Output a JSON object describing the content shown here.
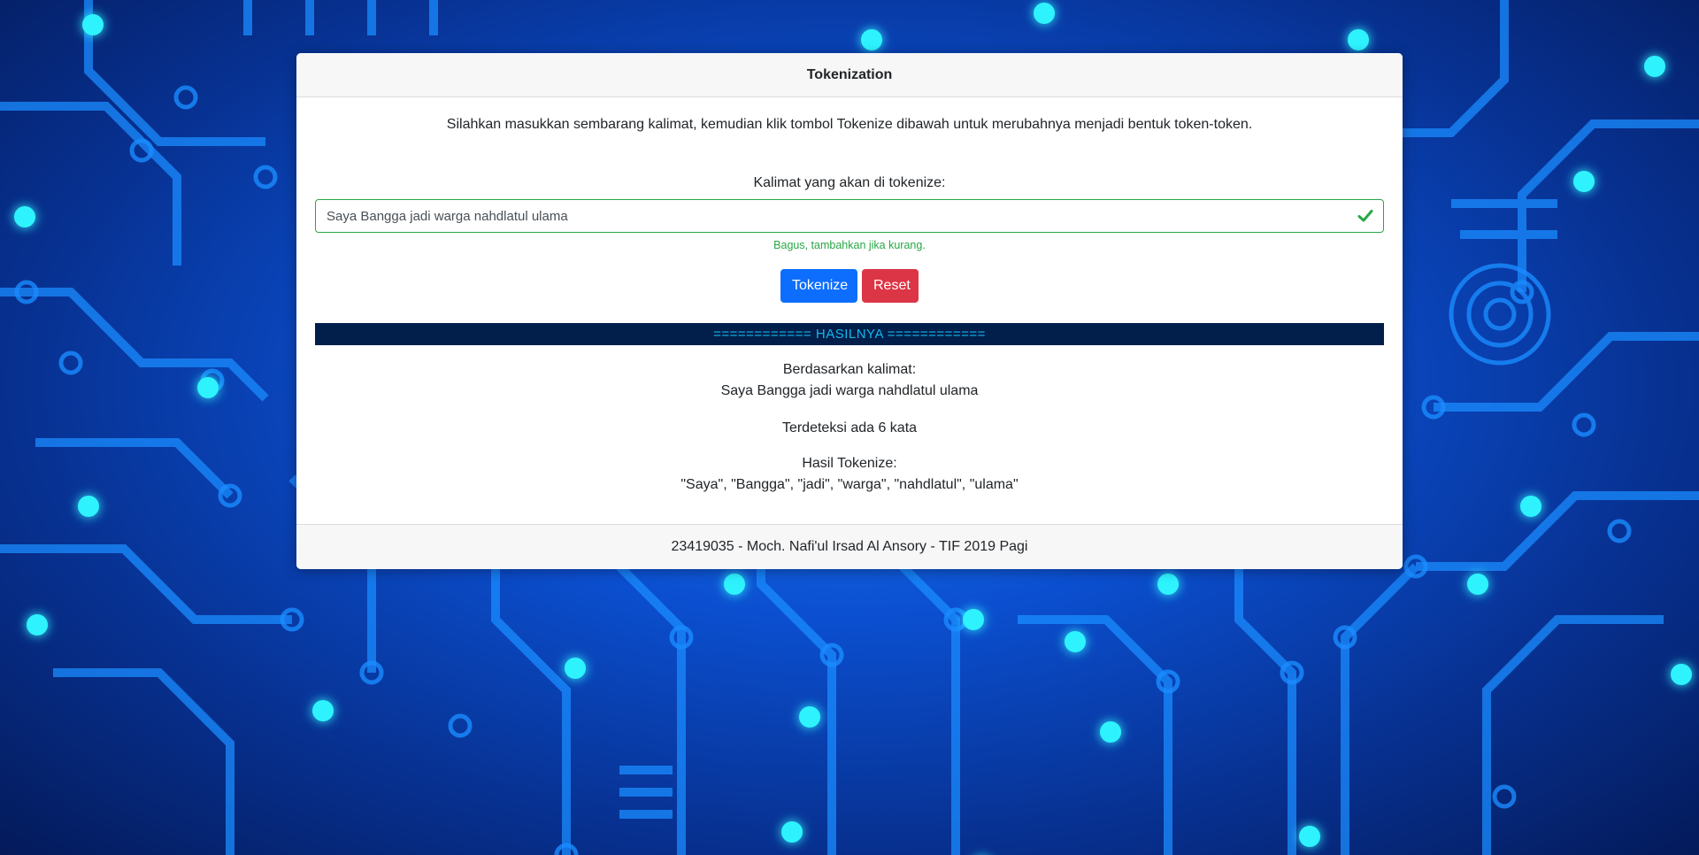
{
  "card": {
    "title": "Tokenization",
    "intro": "Silahkan masukkan sembarang kalimat, kemudian klik tombol Tokenize dibawah untuk merubahnya menjadi bentuk token-token.",
    "input_label": "Kalimat yang akan di tokenize:",
    "input_value": "Saya Bangga jadi warga nahdlatul ulama",
    "valid_feedback": "Bagus, tambahkan jika kurang.",
    "tokenize_button": "Tokenize",
    "reset_button": "Reset",
    "result_banner": "============ HASILNYA ============",
    "based_on_label": "Berdasarkan kalimat:",
    "based_on_value": "Saya Bangga jadi warga nahdlatul ulama",
    "word_count_text": "Terdeteksi ada 6 kata",
    "tokens_label": "Hasil Tokenize:",
    "tokens_value": "\"Saya\", \"Bangga\", \"jadi\", \"warga\", \"nahdlatul\", \"ulama\"",
    "footer": "23419035 - Moch. Nafi'ul Irsad Al Ansory - TIF 2019 Pagi"
  },
  "background": {
    "description_icon": "circuit-board-background",
    "base_color": "#0b4fd0",
    "trace_color": "#1a8cff",
    "glow_color": "#2ff3ff"
  },
  "colors": {
    "primary": "#0d6efd",
    "danger": "#dc3545",
    "success": "#28a745",
    "banner_bg": "#021e4a",
    "banner_text": "#16b7e9"
  }
}
